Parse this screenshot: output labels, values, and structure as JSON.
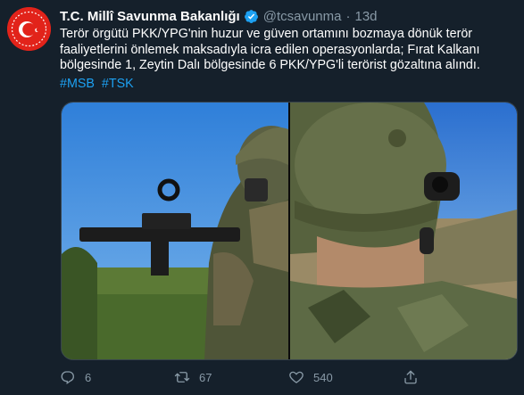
{
  "tweet": {
    "author_name": "T.C. Millî Savunma Bakanlığı",
    "handle": "@tcsavunma",
    "separator": "·",
    "time": "13d",
    "text": "Terör örgütü PKK/YPG'nin huzur ve güven ortamını bozmaya dönük terör faaliyetlerini önlemek maksadıyla icra edilen operasyonlarda; Fırat Kalkanı bölgesinde 1, Zeytin Dalı bölgesinde 6 PKK/YPG'li terörist gözaltına alındı.",
    "hashtags": [
      "#MSB",
      "#TSK"
    ],
    "media": [
      {
        "icon": "soldier-aiming-rifle-photo"
      },
      {
        "icon": "soldier-with-binoculars-photo"
      }
    ]
  },
  "actions": {
    "reply": {
      "icon": "reply-icon",
      "count": "6"
    },
    "retweet": {
      "icon": "retweet-icon",
      "count": "67"
    },
    "like": {
      "icon": "heart-icon",
      "count": "540"
    },
    "share": {
      "icon": "share-icon"
    }
  },
  "colors": {
    "background": "#15202b",
    "text": "#ffffff",
    "muted": "#8899a6",
    "link": "#1da1f2",
    "verified": "#1da1f2",
    "avatar": "#e2231a"
  }
}
